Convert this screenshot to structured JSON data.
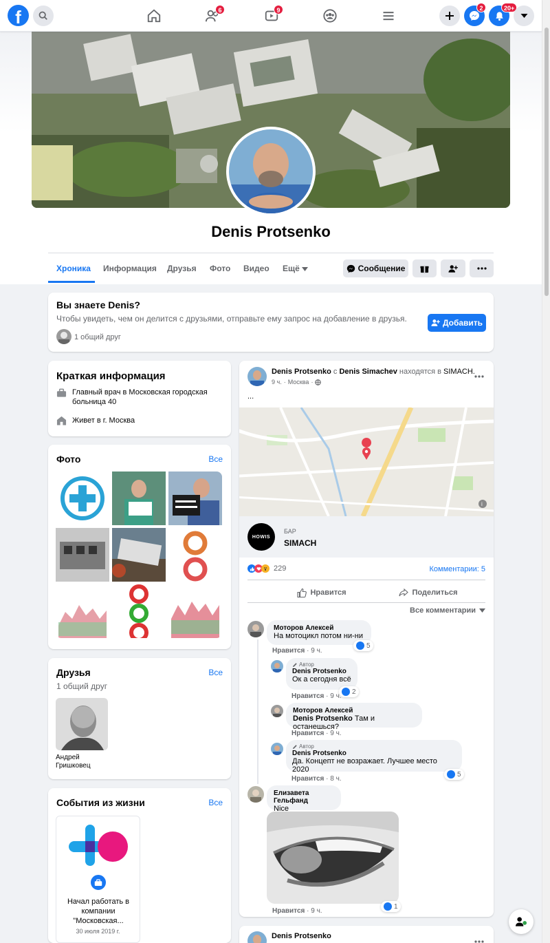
{
  "nav": {
    "badges": {
      "friends": "6",
      "watch": "9",
      "messenger": "2",
      "notifications": "20+"
    }
  },
  "profile": {
    "name": "Denis Protsenko",
    "tabs": [
      "Хроника",
      "Информация",
      "Друзья",
      "Фото",
      "Видео",
      "Ещё"
    ],
    "message_button": "Сообщение"
  },
  "know": {
    "title": "Вы знаете Denis?",
    "text": "Чтобы увидеть, чем он делится с друзьями, отправьте ему запрос на добавление в друзья.",
    "add_button": "Добавить",
    "mutual": "1 общий друг"
  },
  "intro": {
    "title": "Краткая информация",
    "work": "Главный врач в Московская городская больница 40",
    "lives": "Живет в г. Москва"
  },
  "photos": {
    "title": "Фото",
    "see_all": "Все"
  },
  "friends": {
    "title": "Друзья",
    "see_all": "Все",
    "subtitle": "1 общий друг",
    "friend_name": "Андрей Гришковец"
  },
  "life_events": {
    "title": "События из жизни",
    "see_all": "Все",
    "event_text": "Начал работать в компании \"Московская...",
    "event_date": "30 июля 2019 г."
  },
  "post": {
    "author": "Denis Protsenko",
    "with_word": "с",
    "with": "Denis Simachev",
    "at_word": "находятся в",
    "place": "SIMACH.",
    "time": "9 ч.",
    "location": "Москва",
    "body": "...",
    "place_card": {
      "category": "БАР",
      "name": "SIMACH",
      "logo_text": "HOWIS"
    },
    "reactions_count": "229",
    "comments_count": "Комментарии: 5",
    "like_label": "Нравится",
    "share_label": "Поделиться",
    "all_comments": "Все комментарии",
    "comments": [
      {
        "author": "Моторов Алексей",
        "text": "На мотоцикл потом ни-ни",
        "like": "Нравится",
        "time": "9 ч.",
        "reacts": "5"
      },
      {
        "badge": "Автор",
        "author": "Denis Protsenko",
        "text": "Ок а сегодня всё",
        "like": "Нравится",
        "time": "9 ч.",
        "reacts": "2"
      },
      {
        "author": "Моторов Алексей",
        "mention": "Denis Protsenko",
        "text": "Там и останешься?",
        "like": "Нравится",
        "time": "9 ч."
      },
      {
        "badge": "Автор",
        "author": "Denis Protsenko",
        "text": "Да. Концепт не возражает. Лучшее место 2020",
        "like": "Нравится",
        "time": "8 ч.",
        "reacts": "5"
      },
      {
        "author": "Елизавета Гельфанд",
        "text": "Nice",
        "like": "Нравится",
        "time": "9 ч.",
        "reacts": "1"
      }
    ]
  },
  "post2": {
    "author": "Denis Protsenko"
  },
  "colors": {
    "accent": "#1877f2",
    "background": "#f0f2f5",
    "badge": "#e41e3f"
  }
}
